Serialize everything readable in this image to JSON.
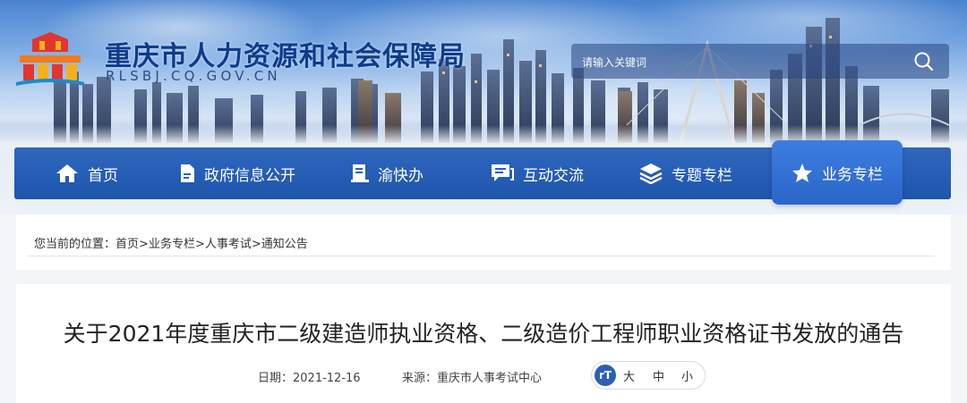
{
  "header": {
    "site_title": "重庆市人力资源和社会保障局",
    "site_domain": "RLSBJ.CQ.GOV.CN",
    "search_placeholder": "请输入关键词"
  },
  "nav": {
    "items": [
      {
        "label": "首页",
        "icon": "home-icon"
      },
      {
        "label": "政府信息公开",
        "icon": "document-icon"
      },
      {
        "label": "渝快办",
        "icon": "service-icon"
      },
      {
        "label": "互动交流",
        "icon": "chat-icon"
      },
      {
        "label": "专题专栏",
        "icon": "layers-icon"
      },
      {
        "label": "业务专栏",
        "icon": "star-icon",
        "active": true
      }
    ]
  },
  "breadcrumb": {
    "prefix": "您当前的位置：",
    "items": [
      "首页",
      "业务专栏",
      "人事考试",
      "通知公告"
    ],
    "separator": ">"
  },
  "article": {
    "title": "关于2021年度重庆市二级建造师执业资格、二级造价工程师职业资格证书发放的通告",
    "date_label": "日期：",
    "date": "2021-12-16",
    "source_label": "来源：",
    "source": "重庆市人事考试中心",
    "font_size_options": [
      "大",
      "中",
      "小"
    ]
  },
  "colors": {
    "nav_bg": "#1e55ad",
    "nav_active": "#3e7de0",
    "title_blue": "#0e3b8c"
  }
}
